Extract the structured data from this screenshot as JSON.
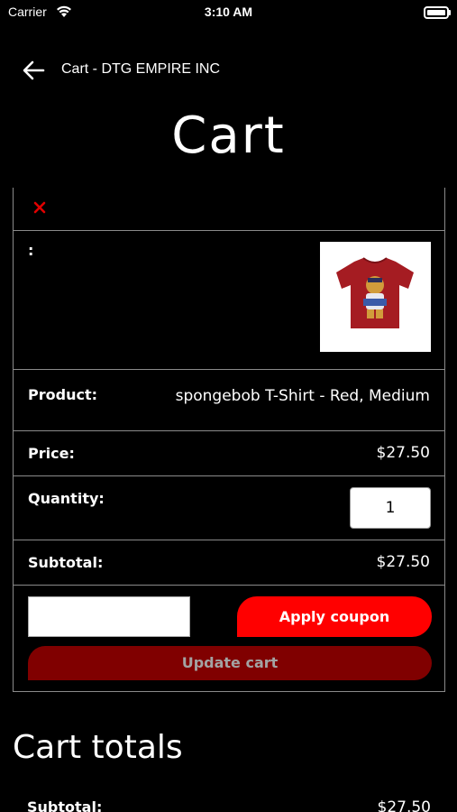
{
  "status_bar": {
    "carrier": "Carrier",
    "time": "3:10 AM"
  },
  "nav": {
    "title": "Cart - DTG EMPIRE INC",
    "back_icon": "arrow-left-icon"
  },
  "page": {
    "title": "Cart"
  },
  "cart_item": {
    "remove_icon": "close-x-icon",
    "remove_color": "#e00000",
    "thumbnail_label": ":",
    "thumbnail_icon": "red-tshirt-image",
    "product_label": "Product:",
    "product_value": "spongebob T-Shirt - Red, Medium",
    "price_label": "Price:",
    "price_value": "$27.50",
    "quantity_label": "Quantity:",
    "quantity_value": "1",
    "subtotal_label": "Subtotal:",
    "subtotal_value": "$27.50"
  },
  "actions": {
    "coupon_placeholder": "",
    "apply_coupon_label": "Apply coupon",
    "update_cart_label": "Update cart",
    "accent_color": "#ff0000",
    "update_color": "#800000"
  },
  "totals": {
    "title": "Cart totals",
    "subtotal_label": "Subtotal:",
    "subtotal_value": "$27.50"
  }
}
